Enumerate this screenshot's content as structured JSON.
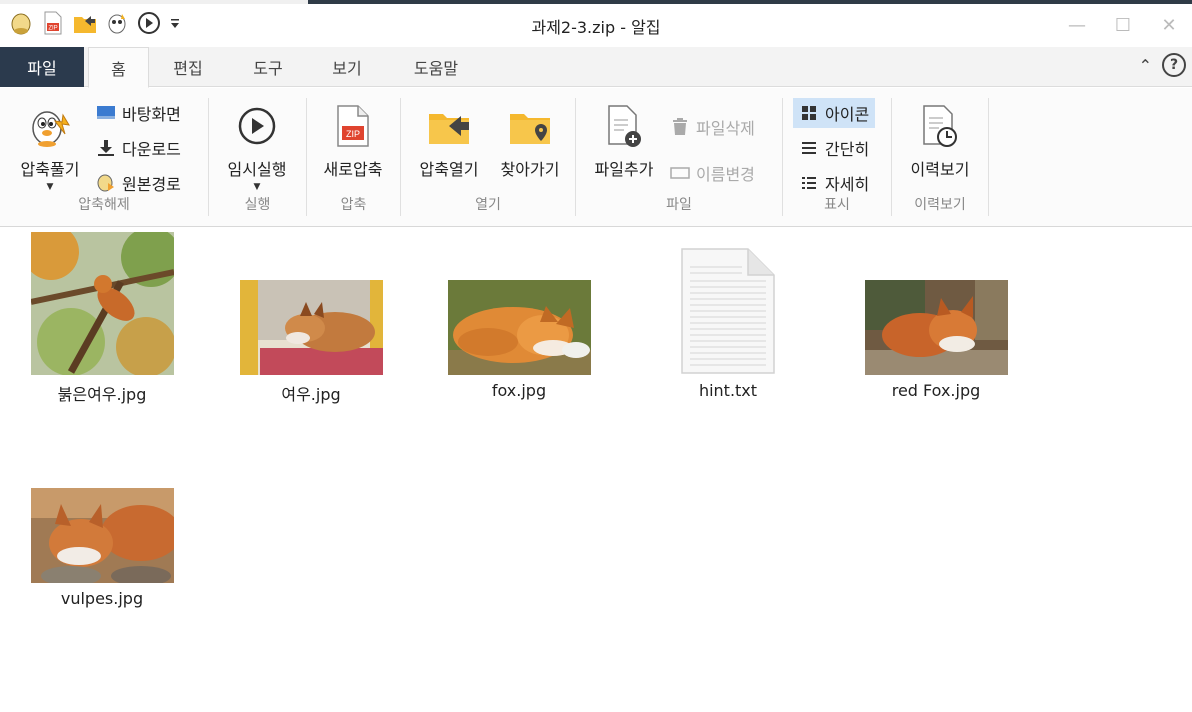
{
  "window": {
    "title": "과제2-3.zip - 알집"
  },
  "quick_access": [
    "alzip-logo-icon",
    "new-zip-icon",
    "open-archive-icon",
    "extract-wizard-icon",
    "play-icon",
    "customize-dropdown-icon"
  ],
  "tabs": [
    {
      "label": "파일",
      "active": false
    },
    {
      "label": "홈",
      "active": true
    },
    {
      "label": "편집",
      "active": false
    },
    {
      "label": "도구",
      "active": false
    },
    {
      "label": "보기",
      "active": false
    },
    {
      "label": "도움말",
      "active": false
    }
  ],
  "help_label": "?",
  "ribbon": {
    "extract": {
      "label": "압축해제",
      "big": "압축풀기",
      "items": [
        "바탕화면",
        "다운로드",
        "원본경로"
      ]
    },
    "run": {
      "label": "실행",
      "big": "임시실행"
    },
    "compress": {
      "label": "압축",
      "big": "새로압축"
    },
    "open": {
      "label": "열기",
      "open_big": "압축열기",
      "goto_big": "찾아가기"
    },
    "file": {
      "label": "파일",
      "add_big": "파일추가",
      "delete": "파일삭제",
      "rename": "이름변경"
    },
    "view": {
      "label": "표시",
      "icon": "아이콘",
      "simple": "간단히",
      "detail": "자세히"
    },
    "history": {
      "label": "이력보기",
      "big": "이력보기"
    }
  },
  "files": [
    {
      "name": "붉은여우.jpg",
      "type": "image"
    },
    {
      "name": "여우.jpg",
      "type": "image"
    },
    {
      "name": "fox.jpg",
      "type": "image"
    },
    {
      "name": "hint.txt",
      "type": "text"
    },
    {
      "name": "red Fox.jpg",
      "type": "image"
    },
    {
      "name": "vulpes.jpg",
      "type": "image"
    }
  ],
  "colors": {
    "file_tab": "#2b3a4d",
    "selected_view": "#cfe3f7",
    "folder": "#f5b82e",
    "zip_red": "#e0442f"
  }
}
